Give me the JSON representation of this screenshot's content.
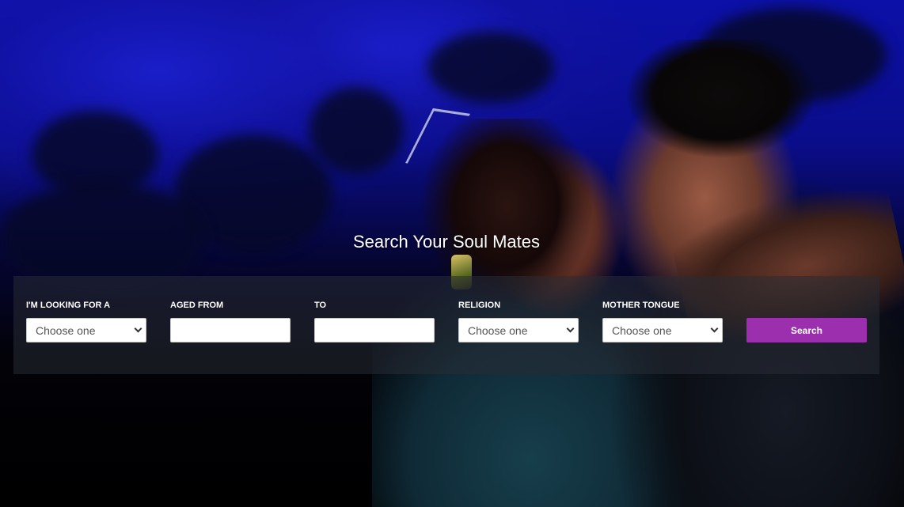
{
  "hero": {
    "title": "Search Your Soul Mates"
  },
  "search_form": {
    "looking_for": {
      "label": "I'M LOOKING FOR A",
      "value": "Choose one"
    },
    "aged_from": {
      "label": "AGED FROM",
      "value": ""
    },
    "aged_to": {
      "label": "TO",
      "value": ""
    },
    "religion": {
      "label": "RELIGION",
      "value": "Choose one"
    },
    "mother_tongue": {
      "label": "MOTHER TONGUE",
      "value": "Choose one"
    },
    "search_button": "Search"
  },
  "colors": {
    "button": "#9b2fae",
    "panel": "rgba(40,44,52,0.55)",
    "sky": "#0c10a8"
  }
}
